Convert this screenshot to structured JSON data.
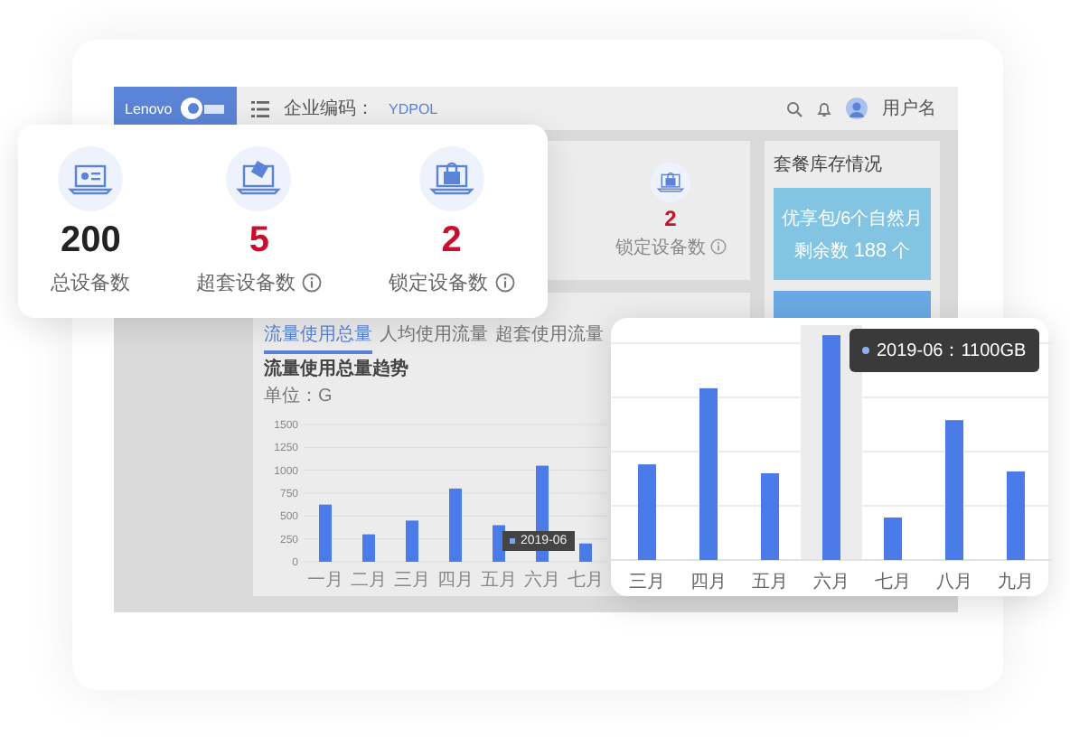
{
  "header": {
    "brand": "Lenovo",
    "company_label": "企业编码：",
    "company_code": "YDPOL",
    "user": "用户名"
  },
  "stats_panel": {
    "value": "2",
    "label": "锁定设备数",
    "alert": true,
    "info": true
  },
  "package_panel": {
    "title": "套餐库存情况",
    "cards": [
      {
        "name": "优享包/6个自然月",
        "count_label": "剩余数",
        "count": "188",
        "unit": "个"
      }
    ]
  },
  "usage_panel": {
    "tabs": [
      {
        "label": "流量使用总量",
        "selected": true
      },
      {
        "label": "人均使用流量",
        "selected": false
      },
      {
        "label": "超套使用流量",
        "selected": false
      }
    ],
    "chart_data": {
      "type": "bar",
      "title": "流量使用总量趋势",
      "ylabel": "单位：G",
      "categories": [
        "一月",
        "二月",
        "三月",
        "四月",
        "五月",
        "六月",
        "七月"
      ],
      "values": [
        625,
        300,
        450,
        800,
        400,
        1050,
        200
      ],
      "grid": true,
      "ylim": [
        0,
        1500
      ],
      "yticks": [
        0,
        250,
        500,
        750,
        1000,
        1250,
        1500
      ]
    },
    "tooltip": "2019-06"
  },
  "overview_card": {
    "stats": [
      {
        "kind": "total",
        "value": "200",
        "label": "总设备数",
        "alert": false,
        "info": false
      },
      {
        "kind": "over",
        "value": "5",
        "label": "超套设备数",
        "alert": true,
        "info": true
      },
      {
        "kind": "locked",
        "value": "2",
        "label": "锁定设备数",
        "alert": true,
        "info": true
      }
    ]
  },
  "zoom_card": {
    "categories": [
      {
        "label": "三月",
        "selected": false
      },
      {
        "label": "四月",
        "selected": false
      },
      {
        "label": "五月",
        "selected": false
      },
      {
        "label": "六月",
        "selected": true
      },
      {
        "label": "七月",
        "selected": false
      },
      {
        "label": "八月",
        "selected": false
      },
      {
        "label": "九月",
        "selected": false
      }
    ],
    "tooltip": "2019-06：1100GB"
  }
}
